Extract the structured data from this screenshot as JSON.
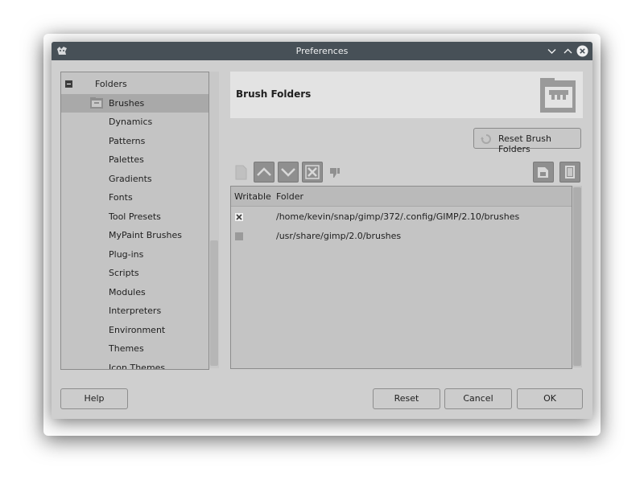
{
  "window": {
    "title": "Preferences"
  },
  "tree": {
    "items": [
      {
        "label": "Folders"
      },
      {
        "label": "Brushes"
      },
      {
        "label": "Dynamics"
      },
      {
        "label": "Patterns"
      },
      {
        "label": "Palettes"
      },
      {
        "label": "Gradients"
      },
      {
        "label": "Fonts"
      },
      {
        "label": "Tool Presets"
      },
      {
        "label": "MyPaint Brushes"
      },
      {
        "label": "Plug-ins"
      },
      {
        "label": "Scripts"
      },
      {
        "label": "Modules"
      },
      {
        "label": "Interpreters"
      },
      {
        "label": "Environment"
      },
      {
        "label": "Themes"
      },
      {
        "label": "Icon Themes"
      }
    ],
    "selected": "Brushes"
  },
  "panel": {
    "title": "Brush Folders",
    "reset_folders_label": "Reset Brush Folders"
  },
  "folder_list": {
    "columns": [
      "Writable",
      "Folder"
    ],
    "rows": [
      {
        "writable": true,
        "folder": "/home/kevin/snap/gimp/372/.config/GIMP/2.10/brushes"
      },
      {
        "writable": false,
        "folder": "/usr/share/gimp/2.0/brushes"
      }
    ]
  },
  "footer": {
    "help": "Help",
    "reset": "Reset",
    "cancel": "Cancel",
    "ok": "OK"
  },
  "colors": {
    "titlebar": "#475057",
    "dialog_bg": "#cfcfcf",
    "selection": "#a9a9a9"
  }
}
